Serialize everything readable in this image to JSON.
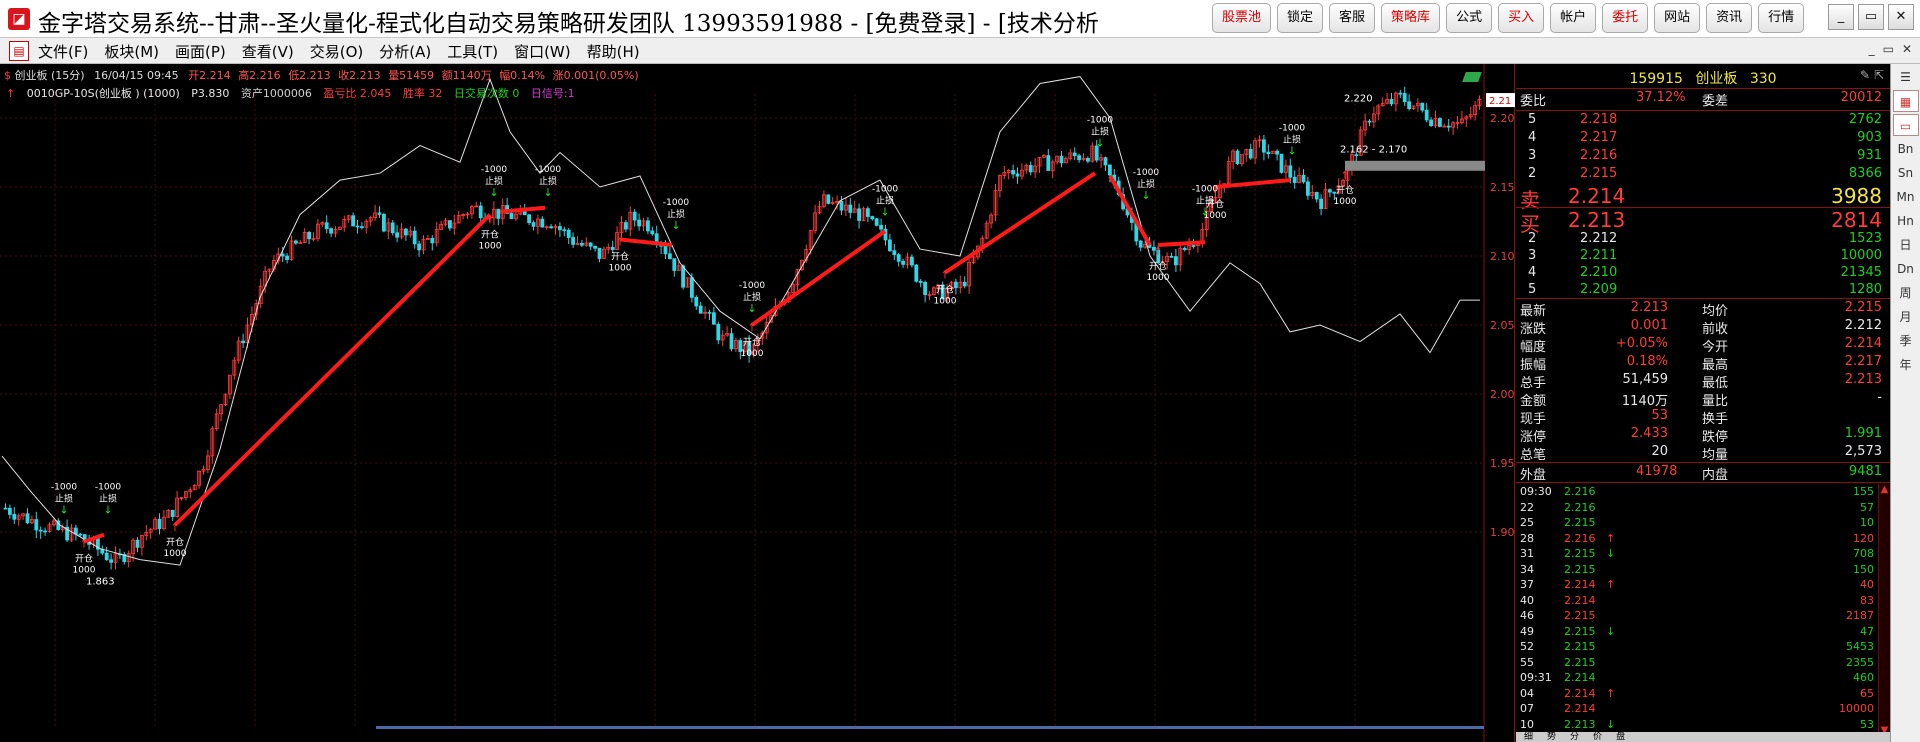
{
  "window": {
    "title": "金字塔交易系统--甘肃--圣火量化-程式化自动交易策略研发团队 13993591988 - [免费登录] - [技术分析",
    "quick_buttons": [
      "股票池",
      "锁定",
      "客服",
      "策略库",
      "公式",
      "买入",
      "帐户",
      "委托",
      "网站",
      "资讯",
      "行情"
    ],
    "controls": [
      "_",
      "▭",
      "✕"
    ]
  },
  "menu": {
    "items": [
      "文件(F)",
      "板块(M)",
      "画面(P)",
      "查看(V)",
      "交易(O)",
      "分析(A)",
      "工具(T)",
      "窗口(W)",
      "帮助(H)"
    ],
    "mdi_controls": [
      "_",
      "▭",
      "✕"
    ]
  },
  "chart": {
    "info_line": {
      "symbol": "创业板 (15分)",
      "datetime": "16/04/15 09:45",
      "open": "开2.214",
      "high": "高2.216",
      "low": "低2.213",
      "close": "收2.213",
      "vol": "量51459",
      "amount": "额1140万",
      "change_pct": "幅0.14%",
      "rise": "涨0.001(0.05%)"
    },
    "strategy_line": {
      "name": "0010GP-10S(创业板 ) (1000)",
      "p": "P3.830",
      "asset": "资产1000006",
      "ratio": "盈亏比 2.045",
      "win": "胜率 32",
      "daily_count": "日交易次数 0",
      "daily_signal": "日信号:1"
    },
    "price_axis": [
      "2.20",
      "2.15",
      "2.10",
      "2.05",
      "2.00",
      "1.95",
      "1.90"
    ],
    "last_price_tag": "2.21",
    "annotations": {
      "high_label": "2.220",
      "low_label": "1.863",
      "range_label": "2.162 - 2.170"
    },
    "signal_labels": {
      "open": "开仓",
      "stop": "止损",
      "qty_pos": "1000",
      "qty_neg": "-1000"
    }
  },
  "quote": {
    "code": "159915",
    "name": "创业板",
    "num": "330",
    "weibi": {
      "label": "委比",
      "value": "37.12%",
      "label2": "委差",
      "value2": "20012"
    },
    "sells": [
      {
        "level": "5",
        "price": "2.218",
        "vol": "2762"
      },
      {
        "level": "4",
        "price": "2.217",
        "vol": "903"
      },
      {
        "level": "3",
        "price": "2.216",
        "vol": "931"
      },
      {
        "level": "2",
        "price": "2.215",
        "vol": "8366"
      }
    ],
    "sell1": {
      "label": "卖",
      "price": "2.214",
      "vol": "3988"
    },
    "buy1": {
      "label": "买",
      "price": "2.213",
      "vol": "2814"
    },
    "buys": [
      {
        "level": "2",
        "price": "2.212",
        "vol": "1523"
      },
      {
        "level": "3",
        "price": "2.211",
        "vol": "10000"
      },
      {
        "level": "4",
        "price": "2.210",
        "vol": "21345"
      },
      {
        "level": "5",
        "price": "2.209",
        "vol": "1280"
      }
    ],
    "stats": [
      [
        "最新",
        "2.213",
        "均价",
        "2.215"
      ],
      [
        "涨跌",
        "0.001",
        "前收",
        "2.212"
      ],
      [
        "幅度",
        "+0.05%",
        "今开",
        "2.214"
      ],
      [
        "振幅",
        "0.18%",
        "最高",
        "2.217"
      ],
      [
        "总手",
        "51,459",
        "最低",
        "2.213"
      ],
      [
        "金额",
        "1140万",
        "量比",
        "-"
      ],
      [
        "现手",
        "53",
        "换手",
        ""
      ],
      [
        "涨停",
        "2.433",
        "跌停",
        "1.991"
      ],
      [
        "总笔",
        "20",
        "均量",
        "2,573"
      ]
    ],
    "outer": {
      "label": "外盘",
      "value": "41978",
      "label2": "内盘",
      "value2": "9481"
    },
    "ticks": [
      {
        "time": "09:30",
        "price": "2.216",
        "arrow": "",
        "vol": "155",
        "color": "green"
      },
      {
        "time": "22",
        "price": "2.216",
        "arrow": "",
        "vol": "57",
        "color": "green"
      },
      {
        "time": "25",
        "price": "2.215",
        "arrow": "",
        "vol": "10",
        "color": "green"
      },
      {
        "time": "28",
        "price": "2.216",
        "arrow": "↑",
        "vol": "120",
        "color": "red"
      },
      {
        "time": "31",
        "price": "2.215",
        "arrow": "↓",
        "vol": "708",
        "color": "green"
      },
      {
        "time": "34",
        "price": "2.215",
        "arrow": "",
        "vol": "150",
        "color": "green"
      },
      {
        "time": "37",
        "price": "2.214",
        "arrow": "↑",
        "vol": "40",
        "color": "red"
      },
      {
        "time": "40",
        "price": "2.214",
        "arrow": "",
        "vol": "83",
        "color": "red"
      },
      {
        "time": "46",
        "price": "2.215",
        "arrow": "",
        "vol": "2187",
        "color": "red"
      },
      {
        "time": "49",
        "price": "2.215",
        "arrow": "↓",
        "vol": "47",
        "color": "green"
      },
      {
        "time": "52",
        "price": "2.215",
        "arrow": "",
        "vol": "5453",
        "color": "green"
      },
      {
        "time": "55",
        "price": "2.215",
        "arrow": "",
        "vol": "2355",
        "color": "green"
      },
      {
        "time": "09:31",
        "price": "2.214",
        "arrow": "",
        "vol": "460",
        "color": "green"
      },
      {
        "time": "04",
        "price": "2.214",
        "arrow": "↑",
        "vol": "65",
        "color": "red"
      },
      {
        "time": "07",
        "price": "2.214",
        "arrow": "",
        "vol": "10000",
        "color": "red"
      },
      {
        "time": "10",
        "price": "2.213",
        "arrow": "↓",
        "vol": "53",
        "color": "green"
      }
    ],
    "side_labels": [
      "Bn",
      "Sn",
      "Mn",
      "Hn",
      "日",
      "Dn",
      "周",
      "月",
      "季",
      "年"
    ],
    "bottom_tabs": [
      "细",
      "势",
      "分",
      "价",
      "盘"
    ]
  },
  "colors": {
    "up": "#ff3b3b",
    "down": "#2fd6e6",
    "trade_line": "#ff1a1a",
    "grid": "#5a1010"
  }
}
